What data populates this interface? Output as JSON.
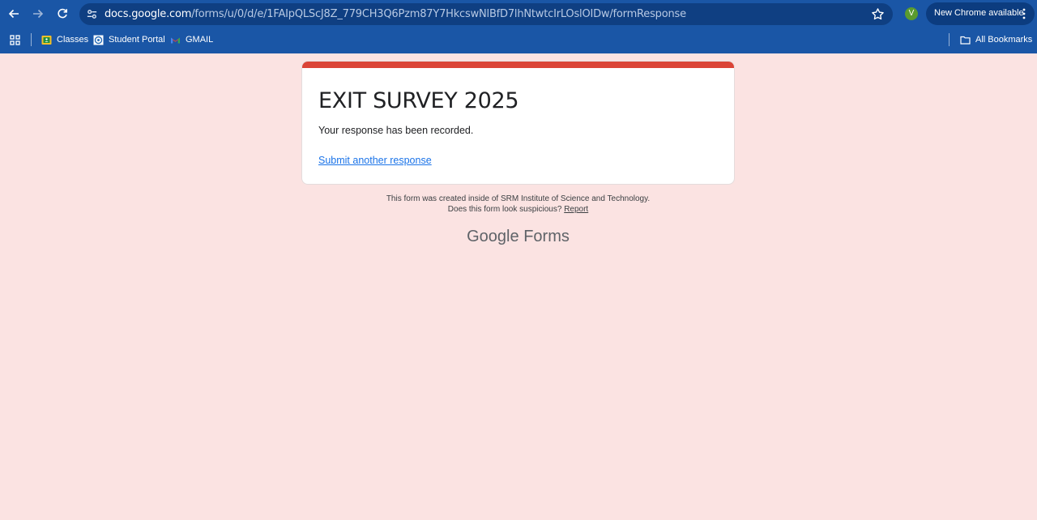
{
  "browser": {
    "url_host": "docs.google.com",
    "url_path": "/forms/u/0/d/e/1FAIpQLScJ8Z_779CH3Q6Pzm87Y7HkcswNlBfD7lhNtwtcIrLOslOIDw/formResponse",
    "profile_initial": "V",
    "update_label": "New Chrome available",
    "bookmarks": [
      {
        "label": "Classes"
      },
      {
        "label": "Student Portal"
      },
      {
        "label": "GMAIL"
      }
    ],
    "all_bookmarks_label": "All Bookmarks"
  },
  "form": {
    "title": "EXIT SURVEY 2025",
    "confirmation": "Your response has been recorded.",
    "submit_another": "Submit another response",
    "accent_color": "#db4437"
  },
  "footer": {
    "created_line": "This form was created inside of SRM Institute of Science and Technology.",
    "suspicious_line": "Does this form look suspicious?",
    "report_label": "Report",
    "logo_google": "Google",
    "logo_forms": "Forms"
  }
}
